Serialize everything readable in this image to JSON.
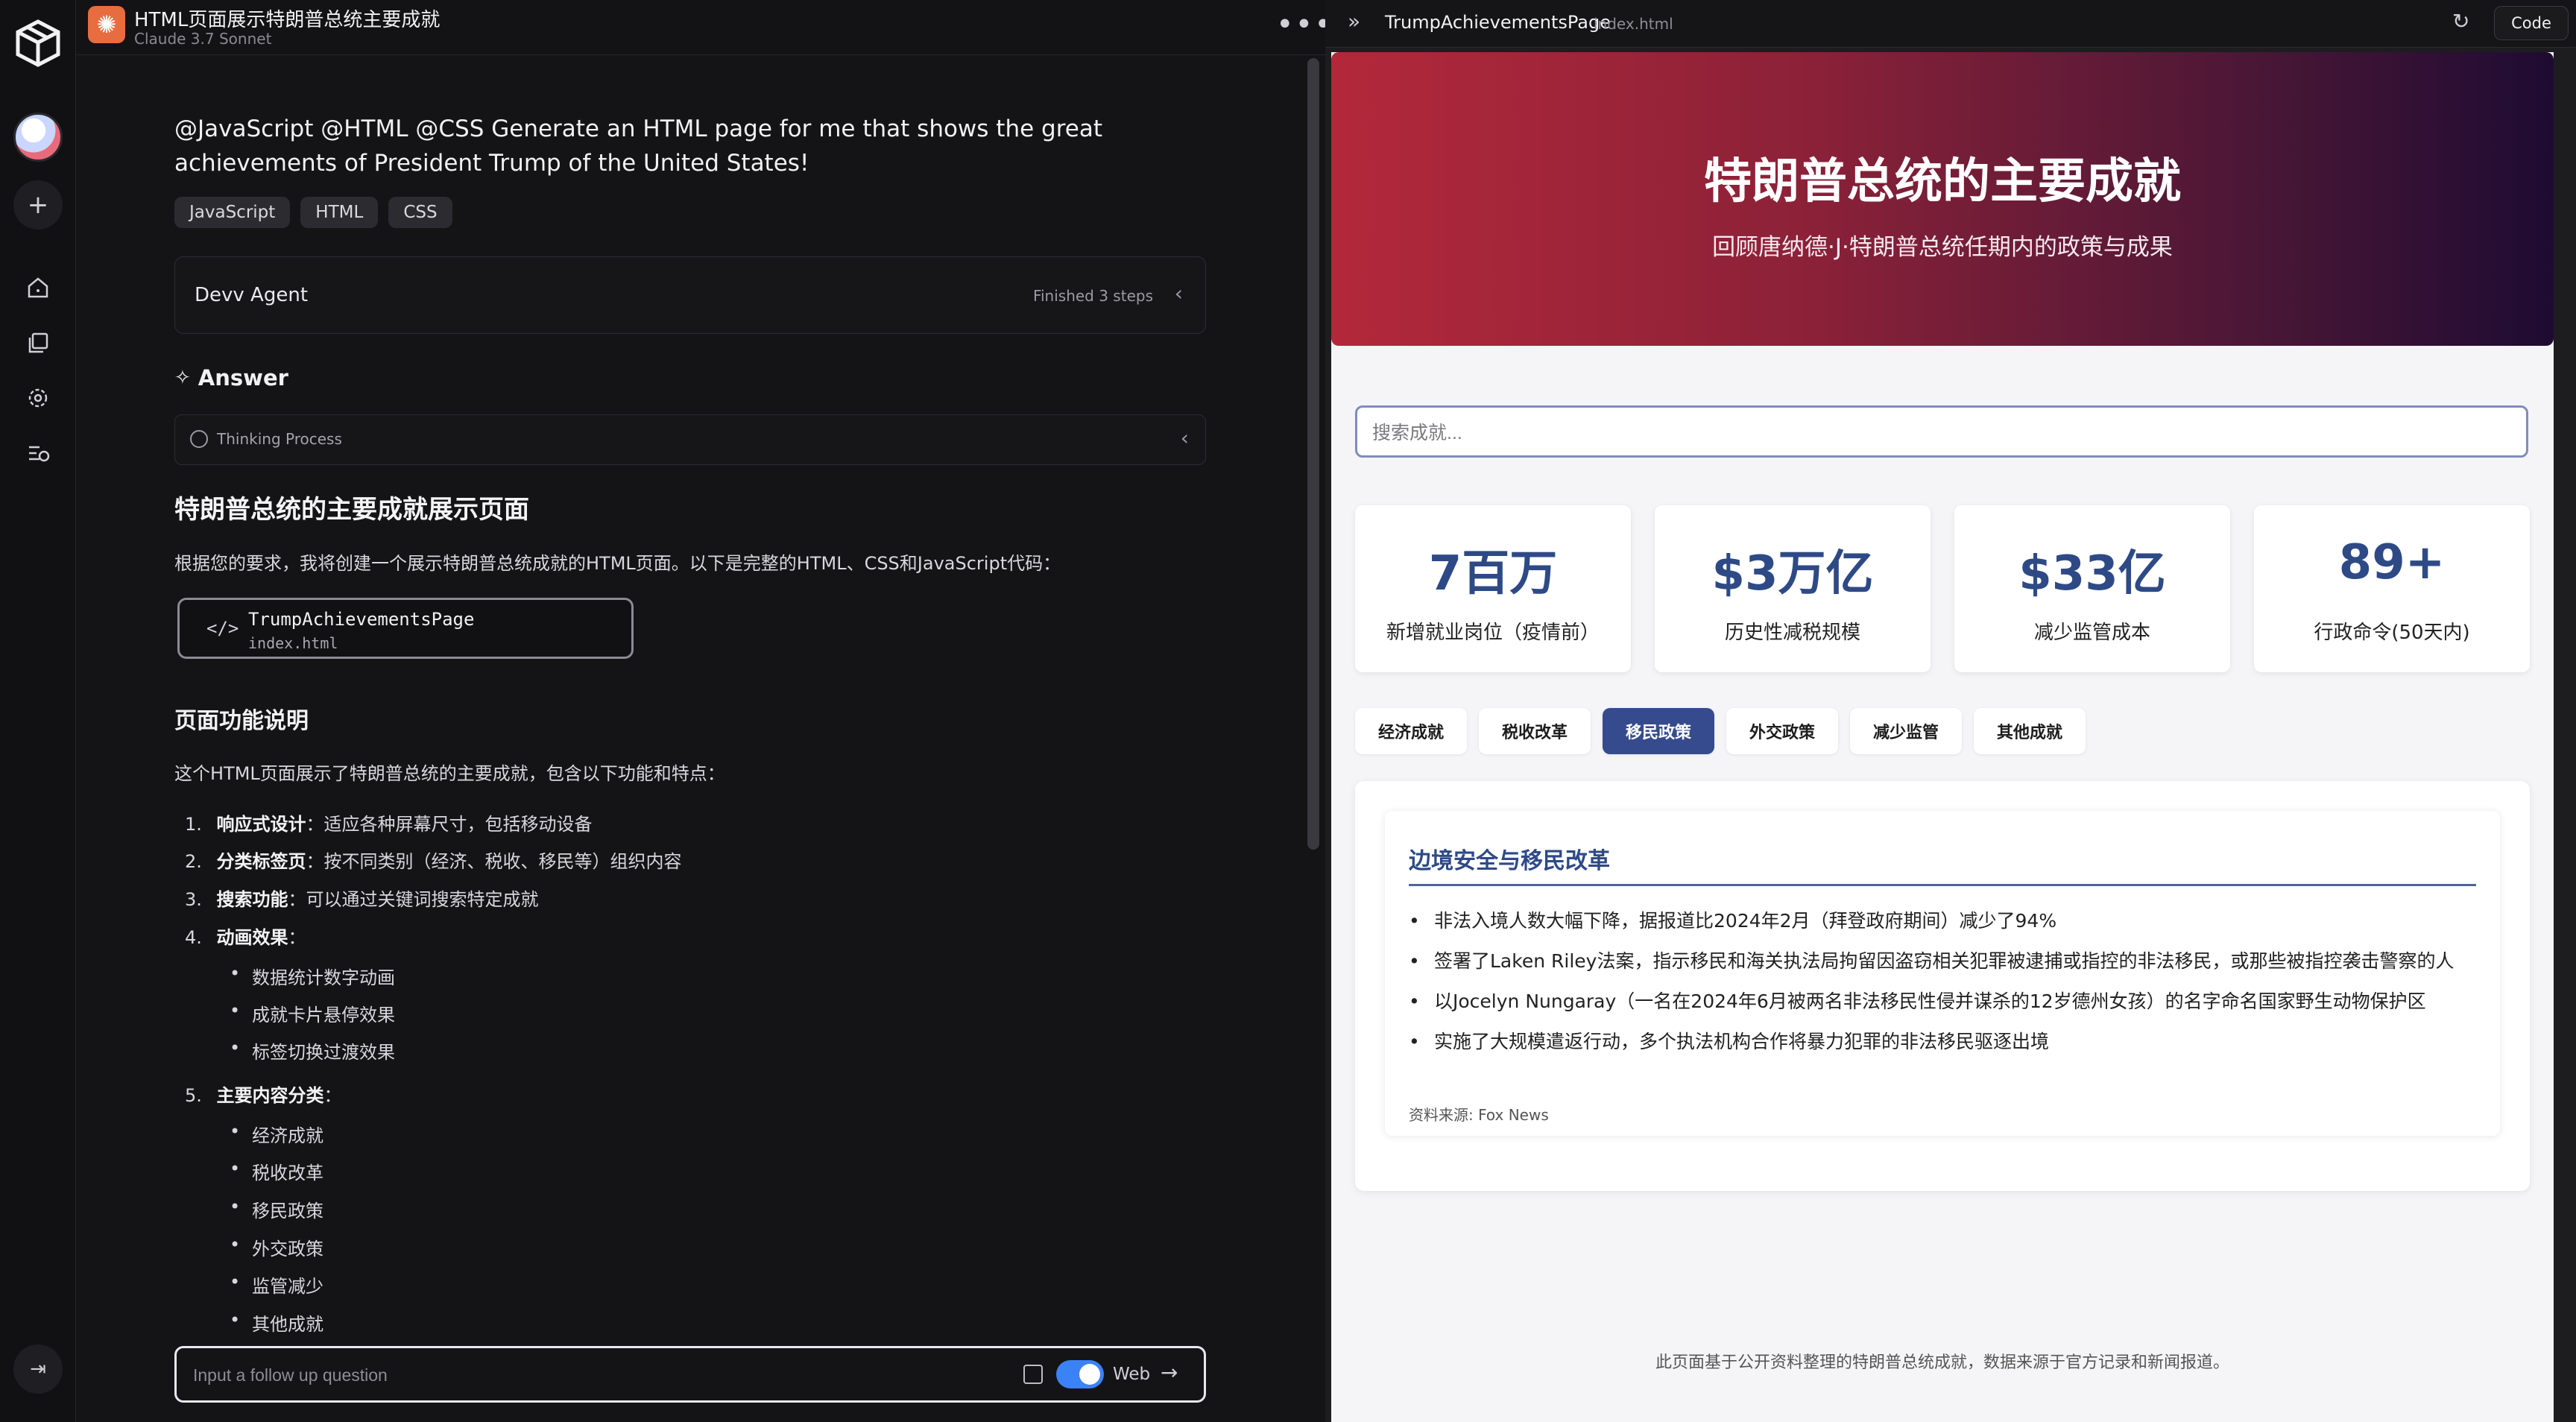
{
  "rail": {
    "icons": [
      "logo-cube-icon",
      "plus-icon",
      "home-icon",
      "library-icon",
      "gear-icon",
      "history-icon",
      "collapse-icon"
    ]
  },
  "chat": {
    "header": {
      "title": "HTML页面展示特朗普总统主要成就",
      "model": "Claude 3.7 Sonnet",
      "more": "•••"
    },
    "prompt": "@JavaScript @HTML @CSS Generate an HTML page for me that shows the great achievements of President Trump of the United States!",
    "tags": [
      "JavaScript",
      "HTML",
      "CSS"
    ],
    "agent": {
      "name": "Devv Agent",
      "status": "Finished 3 steps"
    },
    "answer_heading": "Answer",
    "thinking": "Thinking Process",
    "h2": "特朗普总统的主要成就展示页面",
    "intro": "根据您的要求，我将创建一个展示特朗普总统成就的HTML页面。以下是完整的HTML、CSS和JavaScript代码：",
    "file": {
      "name": "TrumpAchievementsPage",
      "path": "index.html"
    },
    "features_heading": "页面功能说明",
    "features_intro": "这个HTML页面展示了特朗普总统的主要成就，包含以下功能和特点：",
    "features": [
      {
        "num": "1.",
        "bold": "响应式设计",
        "text": "：适应各种屏幕尺寸，包括移动设备"
      },
      {
        "num": "2.",
        "bold": "分类标签页",
        "text": "：按不同类别（经济、税收、移民等）组织内容"
      },
      {
        "num": "3.",
        "bold": "搜索功能",
        "text": "：可以通过关键词搜索特定成就"
      },
      {
        "num": "4.",
        "bold": "动画效果",
        "text": "："
      },
      {
        "num": "5.",
        "bold": "主要内容分类",
        "text": "："
      }
    ],
    "animation_items": [
      "数据统计数字动画",
      "成就卡片悬停效果",
      "标签切换过渡效果"
    ],
    "category_items": [
      "经济成就",
      "税收改革",
      "移民政策",
      "外交政策",
      "监管减少",
      "其他成就"
    ],
    "followup": {
      "placeholder": "Input a follow up question",
      "web_label": "Web",
      "web_enabled": true
    }
  },
  "preview": {
    "header": {
      "name": "TrumpAchievementsPage",
      "file": "index.html",
      "code_label": "Code"
    },
    "hero": {
      "title": "特朗普总统的主要成就",
      "subtitle": "回顾唐纳德·J·特朗普总统任期内的政策与成果",
      "gradient": [
        "#b3283a",
        "#1e0b32"
      ]
    },
    "search_placeholder": "搜索成就...",
    "stats": [
      {
        "value": "7百万",
        "label": "新增就业岗位（疫情前）"
      },
      {
        "value": "$3万亿",
        "label": "历史性减税规模"
      },
      {
        "value": "$33亿",
        "label": "减少监管成本"
      },
      {
        "value": "89+",
        "label": "行政命令(50天内)"
      }
    ],
    "tabs": [
      {
        "label": "经济成就",
        "active": false
      },
      {
        "label": "税收改革",
        "active": false
      },
      {
        "label": "移民政策",
        "active": true
      },
      {
        "label": "外交政策",
        "active": false
      },
      {
        "label": "减少监管",
        "active": false
      },
      {
        "label": "其他成就",
        "active": false
      }
    ],
    "accent": "#354b8d",
    "card": {
      "heading": "边境安全与移民改革",
      "items": [
        "非法入境人数大幅下降，据报道比2024年2月（拜登政府期间）减少了94%",
        "签署了Laken Riley法案，指示移民和海关执法局拘留因盗窃相关犯罪被逮捕或指控的非法移民，或那些被指控袭击警察的人",
        "以Jocelyn Nungaray（一名在2024年6月被两名非法移民性侵并谋杀的12岁德州女孩）的名字命名国家野生动物保护区",
        "实施了大规模遣返行动，多个执法机构合作将暴力犯罪的非法移民驱逐出境"
      ],
      "source": "资料来源: Fox News"
    },
    "footer": "此页面基于公开资料整理的特朗普总统成就，数据来源于官方记录和新闻报道。"
  }
}
